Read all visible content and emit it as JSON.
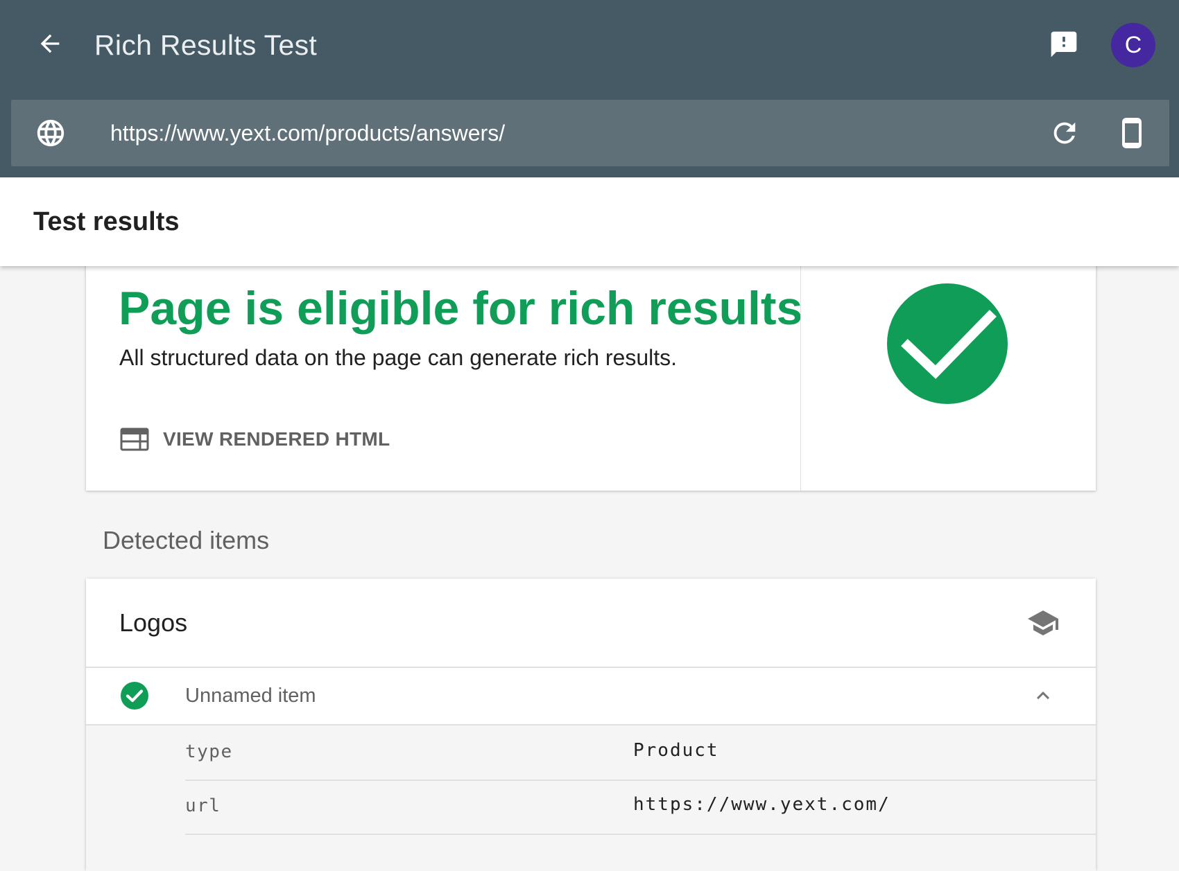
{
  "header": {
    "title": "Rich Results Test",
    "back_icon": "arrow-back-icon",
    "feedback_icon": "feedback-icon",
    "avatar_letter": "C",
    "avatar_color": "#4527a0",
    "background_color": "#455a64"
  },
  "url_bar": {
    "value": "https://www.yext.com/products/answers/",
    "globe_icon": "globe-icon",
    "refresh_icon": "refresh-icon",
    "device_icon": "smartphone-icon"
  },
  "results": {
    "title": "Test results"
  },
  "summary": {
    "headline": "Page is eligible for rich results",
    "subtext": "All structured data on the page can generate rich results.",
    "view_html_label": "VIEW RENDERED HTML",
    "view_html_icon": "web-layout-icon",
    "status_icon": "check-circle-icon",
    "accent_color": "#0f9d58"
  },
  "detected": {
    "heading": "Detected items",
    "card": {
      "title": "Logos",
      "learn_icon": "school-icon",
      "item": {
        "label": "Unnamed item",
        "status_icon": "check-circle-icon",
        "expanded": true
      },
      "properties": [
        {
          "key": "type",
          "value": "Product"
        },
        {
          "key": "url",
          "value": "https://www.yext.com/"
        }
      ]
    }
  }
}
